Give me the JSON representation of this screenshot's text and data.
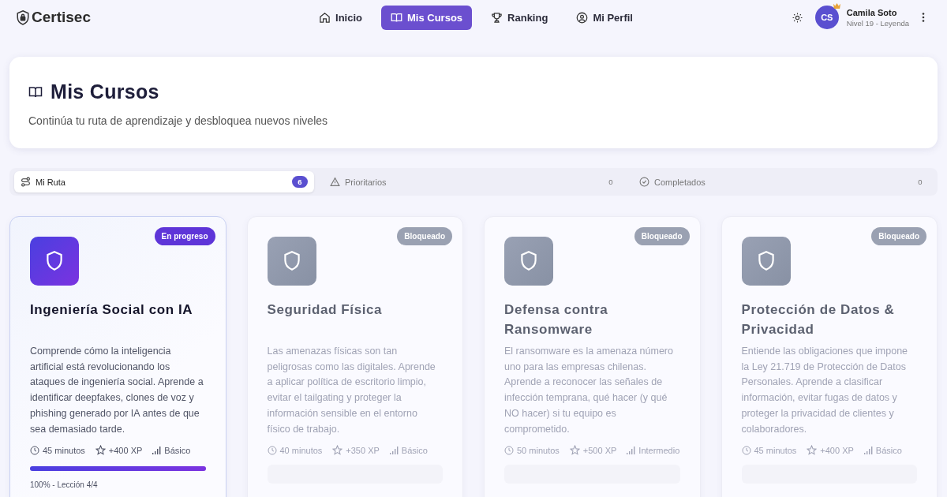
{
  "brand": {
    "name": "Certisec"
  },
  "nav": [
    {
      "label": "Inicio",
      "kind": "home",
      "selected": false
    },
    {
      "label": "Mis Cursos",
      "kind": "book",
      "selected": true
    },
    {
      "label": "Ranking",
      "kind": "trophy",
      "selected": false
    },
    {
      "label": "Mi Perfil",
      "kind": "user",
      "selected": false
    }
  ],
  "user": {
    "initials": "CS",
    "name": "Camila Soto",
    "level": "Nivel 19 - Leyenda"
  },
  "header": {
    "title": "Mis Cursos",
    "subtitle": "Continúa tu ruta de aprendizaje y desbloquea nuevos niveles"
  },
  "filters": [
    {
      "label": "Mi Ruta",
      "kind": "route",
      "count": "6",
      "selected": true
    },
    {
      "label": "Prioritarios",
      "kind": "alert",
      "count": "0",
      "selected": false
    },
    {
      "label": "Completados",
      "kind": "check",
      "count": "0",
      "selected": false
    }
  ],
  "courses": [
    {
      "kind": "in_progress",
      "badge": "En progreso",
      "title": "Ingeniería Social con IA",
      "description": "Comprende cómo la inteligencia artificial está revolucionando los ataques de ingeniería social. Aprende a identificar deepfakes, clones de voz y phishing generado por IA antes de que sea demasiado tarde.",
      "duration": "45 minutos",
      "xp": "+400 XP",
      "difficulty": "Básico",
      "level": 1,
      "progress_text": "100% - Lección 4/4"
    },
    {
      "kind": "locked",
      "badge": "Bloqueado",
      "title": "Seguridad Física",
      "description": "Las amenazas físicas son tan peligrosas como las digitales. Aprende a aplicar política de escritorio limpio, evitar el tailgating y proteger la información sensible en el entorno físico de trabajo.",
      "duration": "40 minutos",
      "xp": "+350 XP",
      "difficulty": "Básico"
    },
    {
      "kind": "locked",
      "badge": "Bloqueado",
      "title": "Defensa contra Ransomware",
      "description": "El ransomware es la amenaza número uno para las empresas chilenas. Aprende a reconocer las señales de infección temprana, qué hacer (y qué NO hacer) si tu equipo es comprometido.",
      "duration": "50 minutos",
      "xp": "+500 XP",
      "difficulty": "Intermedio"
    },
    {
      "kind": "locked",
      "badge": "Bloqueado",
      "title": "Protección de Datos & Privacidad",
      "description": "Entiende las obligaciones que impone la Ley 21.719 de Protección de Datos Personales. Aprende a clasificar información, evitar fugas de datos y proteger la privacidad de clientes y colaboradores.",
      "duration": "45 minutos",
      "xp": "+400 XP",
      "difficulty": "Básico"
    }
  ]
}
